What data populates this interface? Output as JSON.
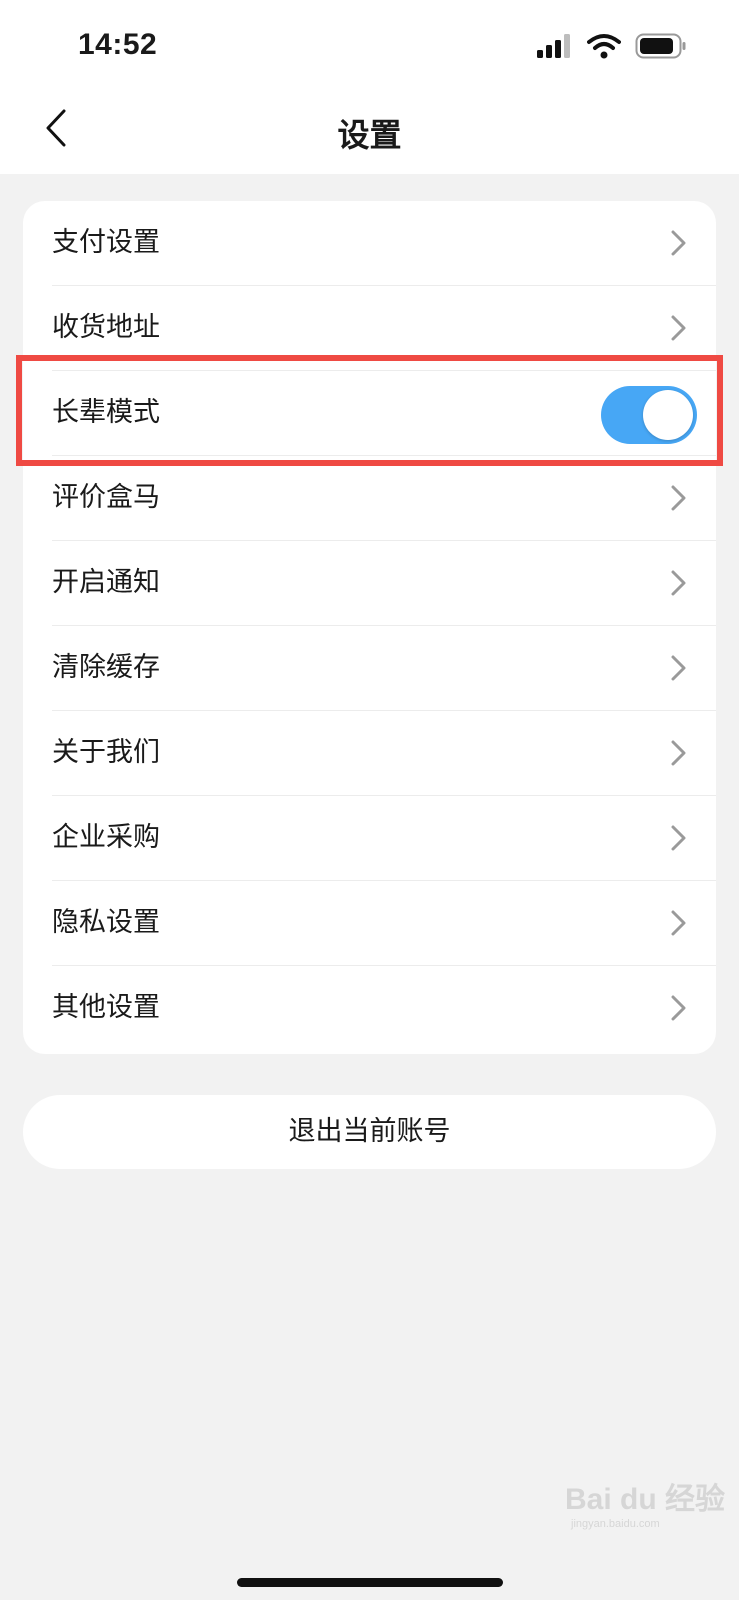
{
  "status_bar": {
    "time": "14:52"
  },
  "nav": {
    "title": "设置"
  },
  "settings": [
    {
      "label": "支付设置",
      "type": "link"
    },
    {
      "label": "收货地址",
      "type": "link"
    },
    {
      "label": "长辈模式",
      "type": "toggle",
      "on": true
    },
    {
      "label": "评价盒马",
      "type": "link"
    },
    {
      "label": "开启通知",
      "type": "link"
    },
    {
      "label": "清除缓存",
      "type": "link"
    },
    {
      "label": "关于我们",
      "type": "link"
    },
    {
      "label": "企业采购",
      "type": "link"
    },
    {
      "label": "隐私设置",
      "type": "link"
    },
    {
      "label": "其他设置",
      "type": "link"
    }
  ],
  "logout_label": "退出当前账号",
  "watermark": {
    "main": "Bai du 经验",
    "sub": "jingyan.baidu.com"
  },
  "colors": {
    "toggle_on": "#47a7f5",
    "highlight": "#ef4a43",
    "background": "#f2f2f2"
  },
  "icons": [
    "signal-icon",
    "wifi-icon",
    "battery-icon",
    "back-arrow-icon",
    "chevron-right-icon"
  ]
}
